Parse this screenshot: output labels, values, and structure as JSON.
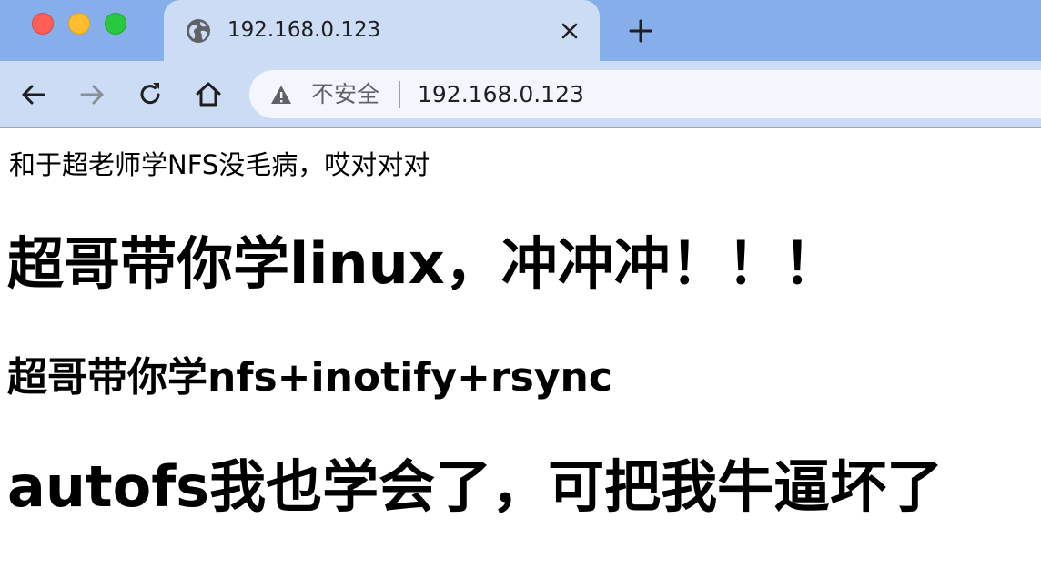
{
  "tab": {
    "title": "192.168.0.123",
    "favicon": "globe-icon",
    "close_icon": "close-icon"
  },
  "new_tab_icon": "plus-icon",
  "toolbar": {
    "back_icon": "back-arrow-icon",
    "forward_icon": "forward-arrow-icon",
    "reload_icon": "reload-icon",
    "home_icon": "home-icon"
  },
  "omnibox": {
    "security_icon": "warning-icon",
    "security_label": "不安全",
    "url": "192.168.0.123"
  },
  "content": {
    "paragraph": "和于超老师学NFS没毛病，哎对对对",
    "heading1": "超哥带你学linux，冲冲冲！！！",
    "heading2": "超哥带你学nfs+inotify+rsync",
    "heading3": "autofs我也学会了，可把我牛逼坏了"
  },
  "colors": {
    "tabstrip_bg": "#86aeea",
    "active_tab_bg": "#cbdcf4",
    "omnibox_bg": "#f3f6fc",
    "close_red": "#ff5f57",
    "minimize_yellow": "#febc2e",
    "zoom_green": "#28c840"
  }
}
